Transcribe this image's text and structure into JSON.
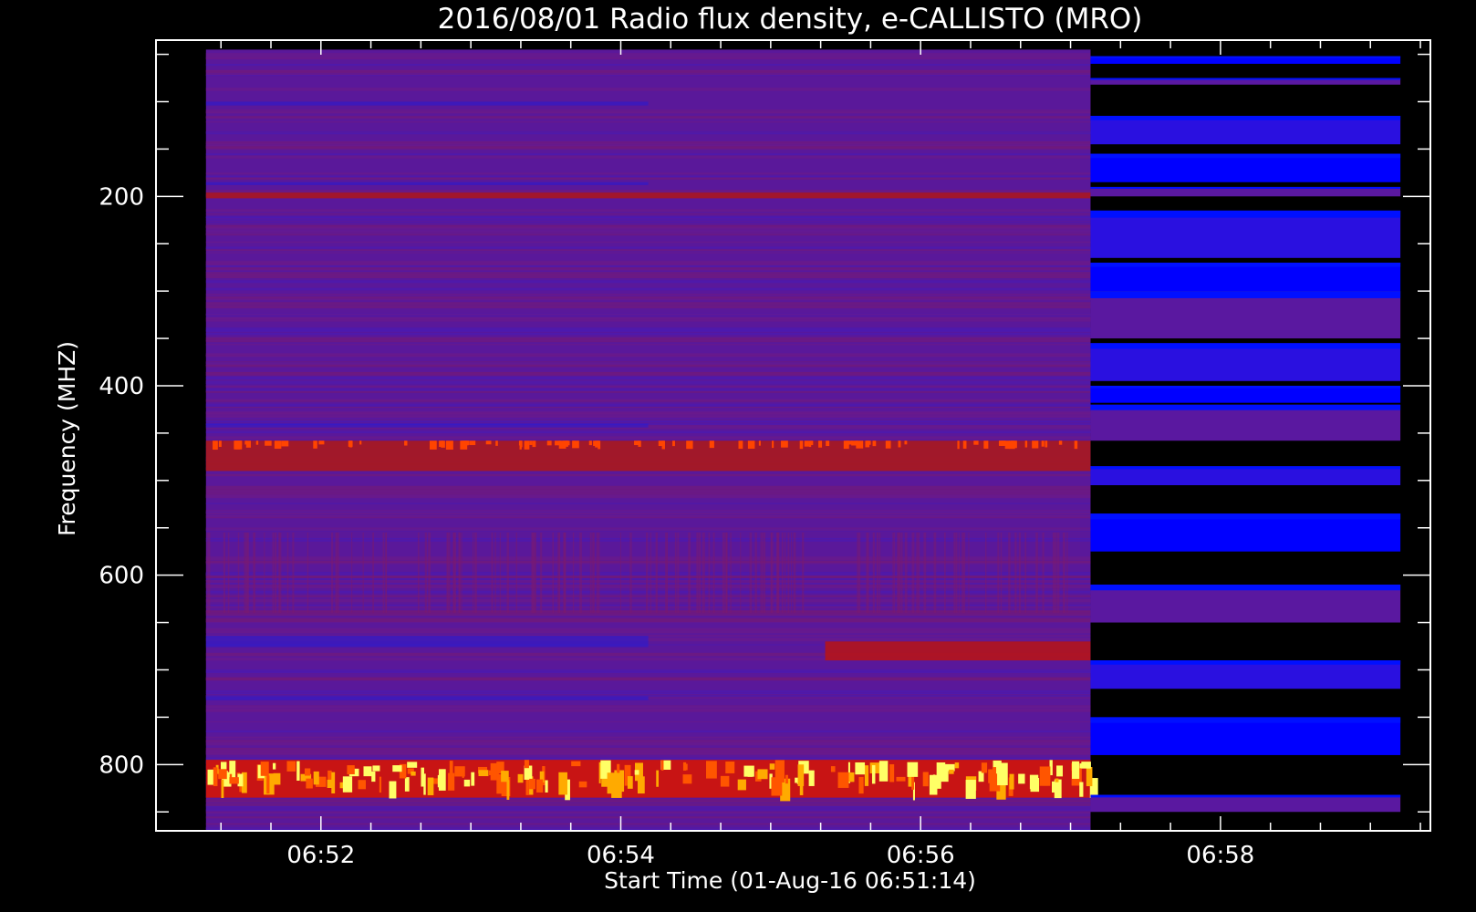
{
  "chart_data": {
    "type": "heatmap",
    "title": "2016/08/01  Radio flux density, e-CALLISTO (MRO)",
    "xlabel": "Start Time (01-Aug-16 06:51:14)",
    "ylabel": "Frequency (MHZ)",
    "x_ticks": [
      "06:52",
      "06:54",
      "06:56",
      "06:58"
    ],
    "y_ticks": [
      "200",
      "400",
      "600",
      "800"
    ],
    "xlim": [
      "06:50:54",
      "06:59:24"
    ],
    "ylim": [
      870,
      35
    ],
    "y_reversed": true,
    "data_x_range": [
      "06:51:14",
      "06:59:12"
    ],
    "data_y_range": [
      45,
      870
    ],
    "colormap": [
      "#000000",
      "#0000ff",
      "#5a189a",
      "#c81414",
      "#ffaa00",
      "#ffff66"
    ],
    "segments": [
      {
        "time_start": "06:51:14",
        "time_end": "06:57:08",
        "appearance": "purple noise with red/yellow bursts"
      },
      {
        "time_start": "06:57:08",
        "time_end": "06:59:12",
        "appearance": "horizontal blue/purple bands with black gaps"
      }
    ],
    "bright_bands_mhz": [
      {
        "from": 458,
        "to": 490,
        "level": "red"
      },
      {
        "from": 795,
        "to": 835,
        "level": "yellow"
      },
      {
        "from": 196,
        "to": 202,
        "level": "red"
      },
      {
        "from": 670,
        "to": 690,
        "level": "red"
      }
    ],
    "right_segment_bands_mhz": [
      [
        52,
        60
      ],
      [
        75,
        82
      ],
      [
        115,
        145
      ],
      [
        155,
        185
      ],
      [
        190,
        200
      ],
      [
        215,
        265
      ],
      [
        270,
        300
      ],
      [
        300,
        350
      ],
      [
        355,
        395
      ],
      [
        400,
        418
      ],
      [
        420,
        458
      ],
      [
        485,
        505
      ],
      [
        535,
        575
      ],
      [
        610,
        650
      ],
      [
        690,
        720
      ],
      [
        750,
        790
      ],
      [
        832,
        850
      ]
    ],
    "grid": false,
    "legend": "none"
  }
}
